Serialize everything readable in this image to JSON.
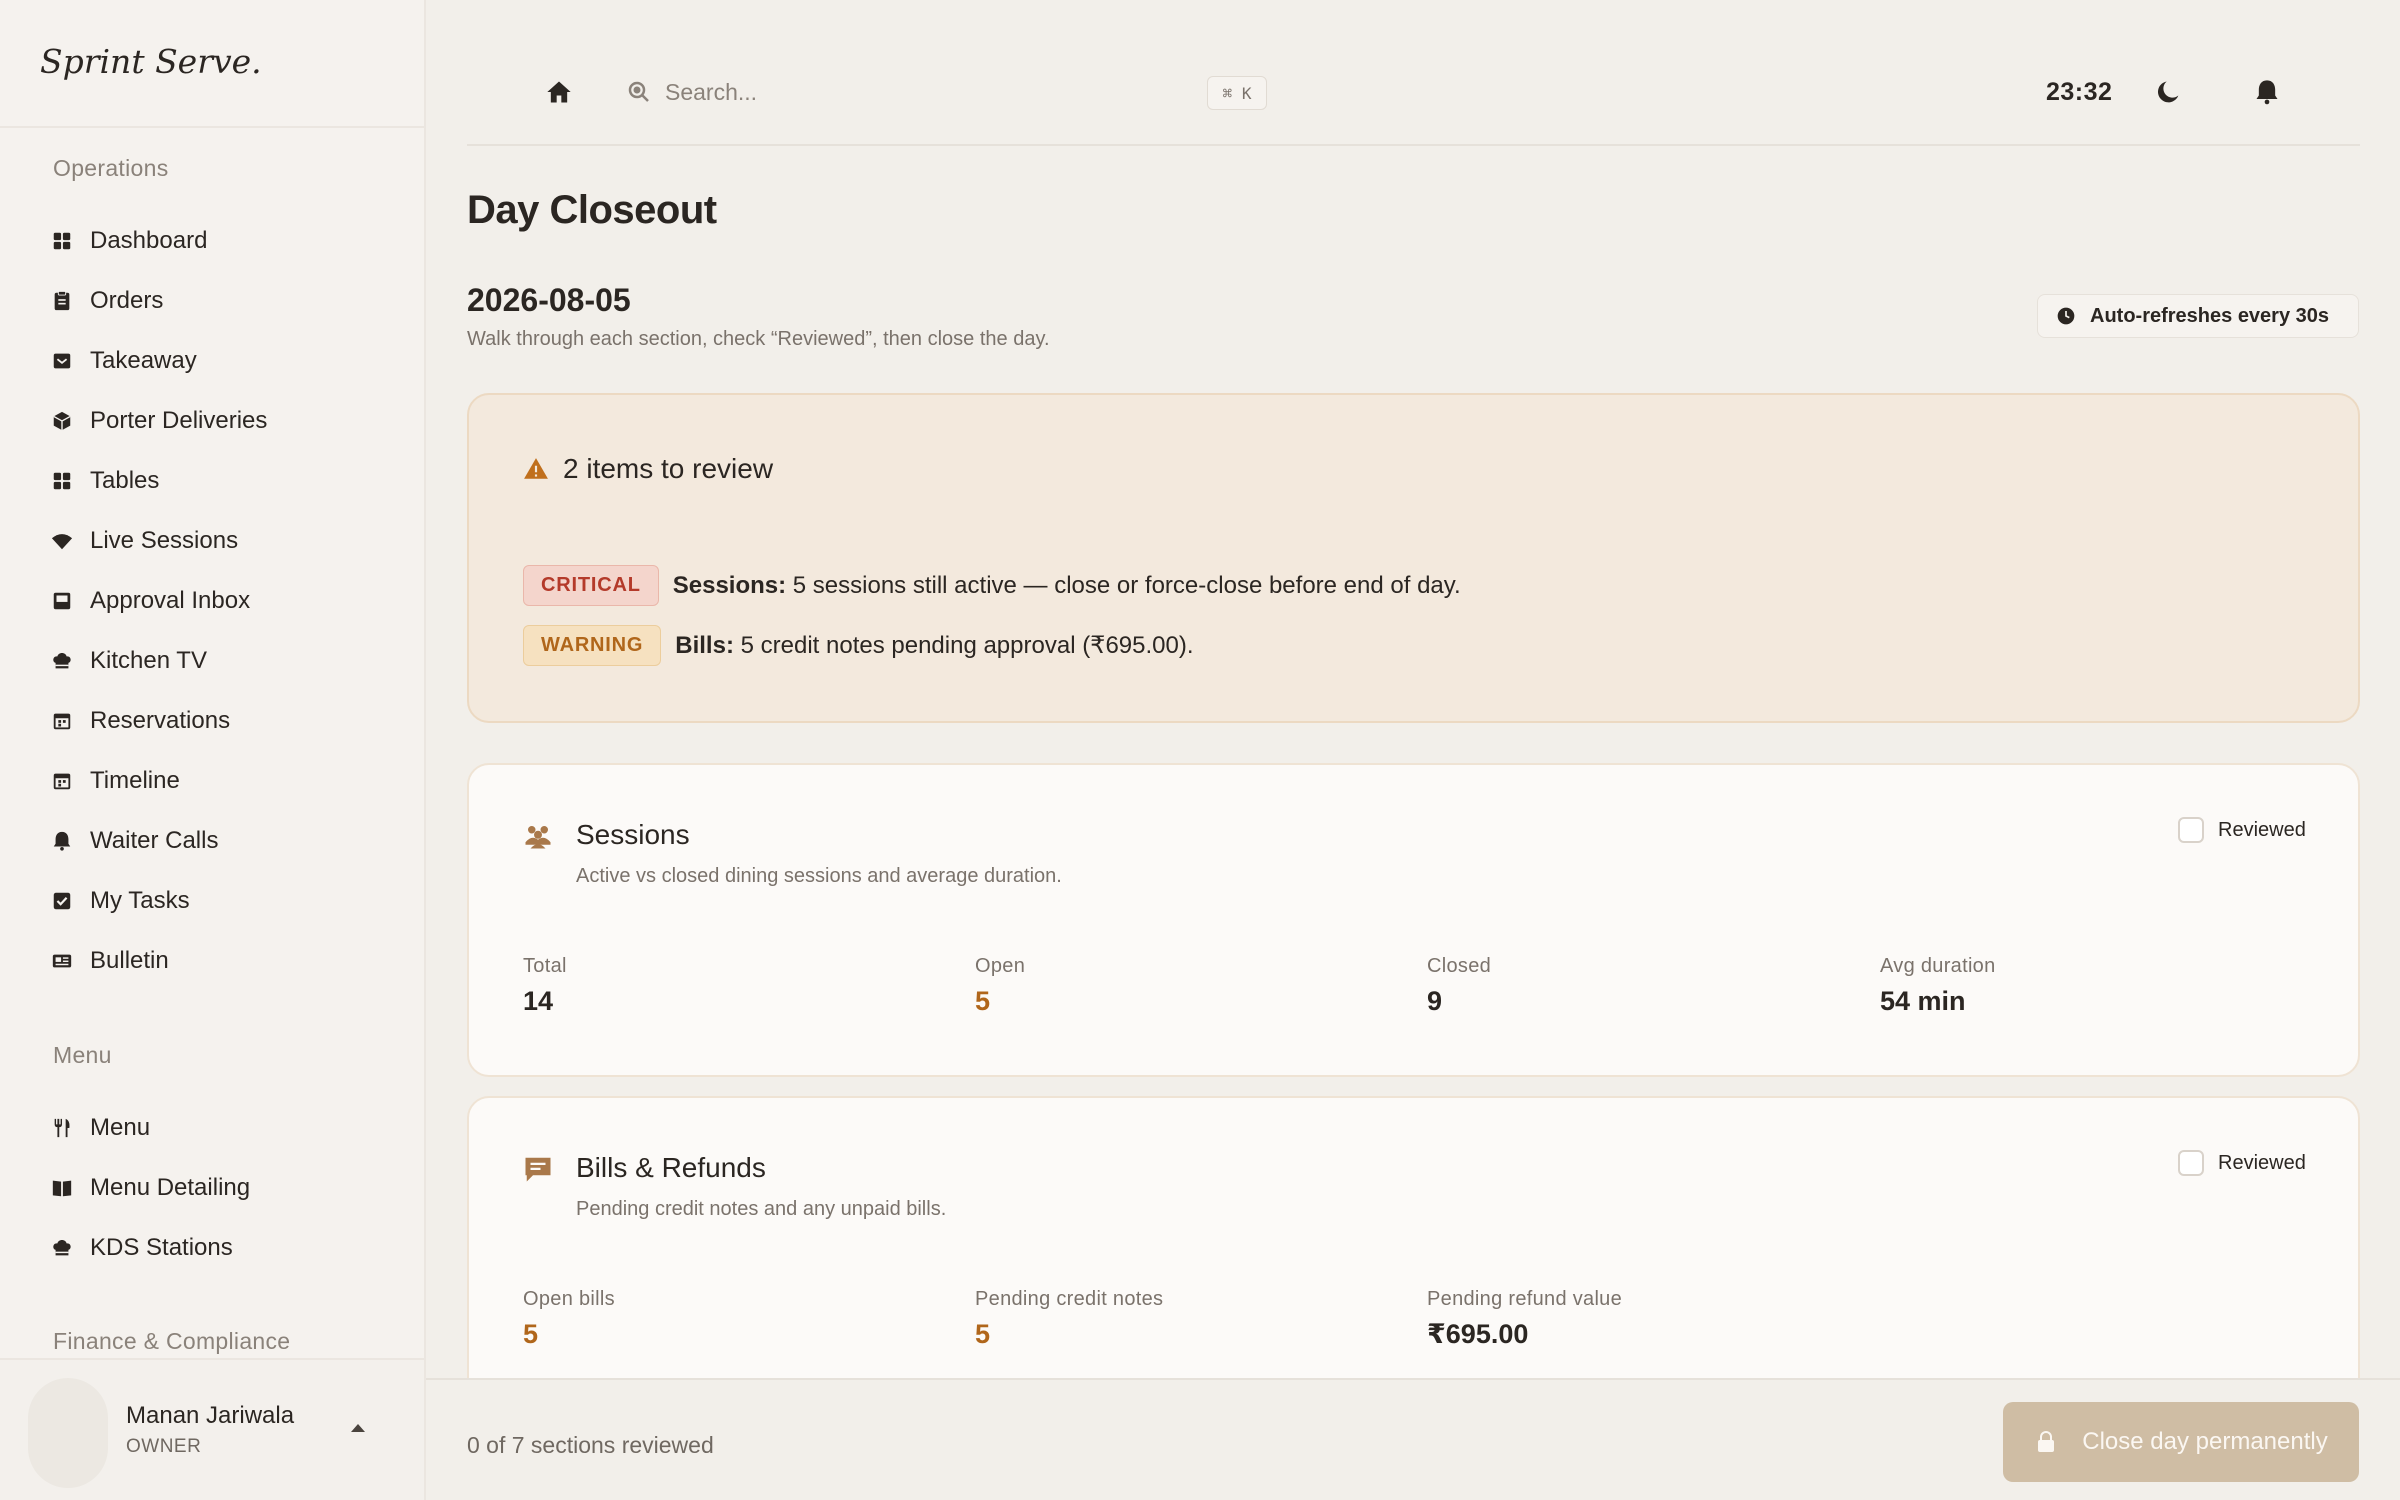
{
  "sidebar": {
    "logo": "Sprint Serve.",
    "sections": {
      "operations": "Operations",
      "menu": "Menu",
      "finance": "Finance & Compliance"
    },
    "operations_items": [
      {
        "label": "Dashboard",
        "icon": "grid-icon"
      },
      {
        "label": "Orders",
        "icon": "clipboard-icon"
      },
      {
        "label": "Takeaway",
        "icon": "takeaway-icon"
      },
      {
        "label": "Porter Deliveries",
        "icon": "package-icon"
      },
      {
        "label": "Tables",
        "icon": "grid-icon"
      },
      {
        "label": "Live Sessions",
        "icon": "wifi-icon"
      },
      {
        "label": "Approval Inbox",
        "icon": "inbox-icon"
      },
      {
        "label": "Kitchen TV",
        "icon": "chef-hat-icon"
      },
      {
        "label": "Reservations",
        "icon": "calendar-icon"
      },
      {
        "label": "Timeline",
        "icon": "calendar-icon"
      },
      {
        "label": "Waiter Calls",
        "icon": "bell-icon"
      },
      {
        "label": "My Tasks",
        "icon": "checkbox-icon"
      },
      {
        "label": "Bulletin",
        "icon": "newspaper-icon"
      }
    ],
    "menu_items": [
      {
        "label": "Menu",
        "icon": "utensils-icon"
      },
      {
        "label": "Menu Detailing",
        "icon": "book-icon"
      },
      {
        "label": "KDS Stations",
        "icon": "chef-hat-icon"
      }
    ],
    "user": {
      "name": "Manan Jariwala",
      "role": "OWNER"
    }
  },
  "topbar": {
    "search_placeholder": "Search...",
    "shortcut": "⌘ K",
    "time": "23:32"
  },
  "page": {
    "title": "Day Closeout",
    "date": "2026-08-05",
    "subtitle": "Walk through each section, check “Reviewed”, then close the day.",
    "auto_refresh": "Auto-refreshes every 30s"
  },
  "review": {
    "heading": "2 items to review",
    "issues": [
      {
        "level": "CRITICAL",
        "section": "Sessions:",
        "text": " 5 sessions still active — close or force-close before end of day."
      },
      {
        "level": "WARNING",
        "section": "Bills:",
        "text": " 5 credit notes pending approval (₹695.00)."
      }
    ]
  },
  "sections": [
    {
      "title": "Sessions",
      "description": "Active vs closed dining sessions and average duration.",
      "reviewed_label": "Reviewed",
      "stats": [
        {
          "label": "Total",
          "value": "14"
        },
        {
          "label": "Open",
          "value": "5"
        },
        {
          "label": "Closed",
          "value": "9"
        },
        {
          "label": "Avg duration",
          "value": "54 min"
        }
      ]
    },
    {
      "title": "Bills & Refunds",
      "description": "Pending credit notes and any unpaid bills.",
      "reviewed_label": "Reviewed",
      "stats": [
        {
          "label": "Open bills",
          "value": "5"
        },
        {
          "label": "Pending credit notes",
          "value": "5"
        },
        {
          "label": "Pending refund value",
          "value": "₹695.00"
        }
      ]
    }
  ],
  "footer": {
    "status": "0 of 7 sections reviewed",
    "close_label": "Close day permanently"
  },
  "colors": {
    "accent": "#b0661b",
    "critical": "#b43a2a",
    "button": "#cfbda4"
  }
}
